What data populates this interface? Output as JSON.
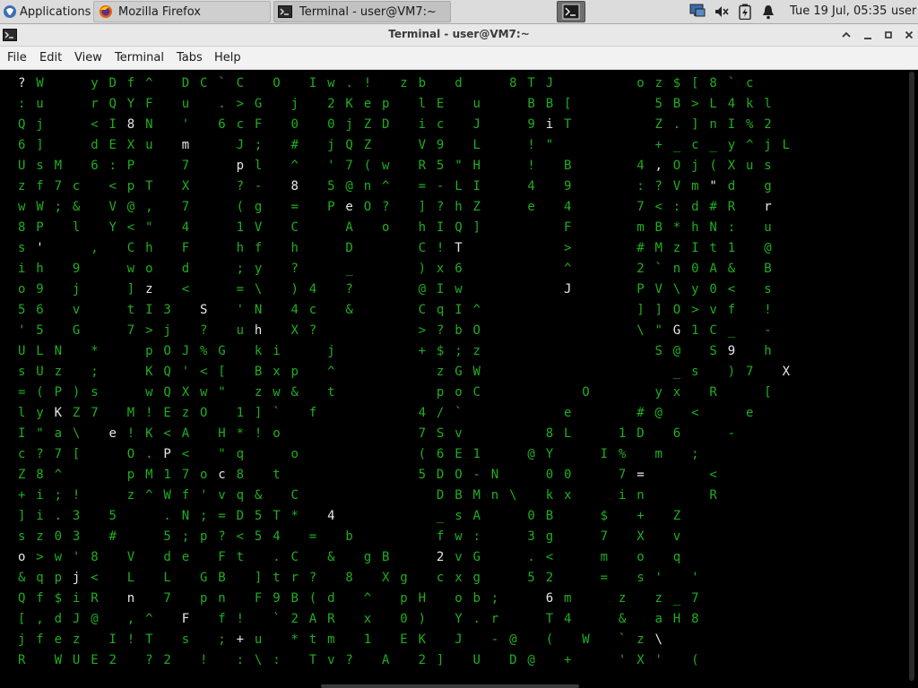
{
  "panel": {
    "apps_label": "Applications",
    "tasks": [
      {
        "label": "Mozilla Firefox"
      },
      {
        "label": "Terminal - user@VM7:~"
      }
    ],
    "clock": "Tue 19 Jul, 05:35",
    "user": "user"
  },
  "window": {
    "title": "Terminal - user@VM7:~"
  },
  "menu": [
    "File",
    "Edit",
    "View",
    "Terminal",
    "Tabs",
    "Help"
  ],
  "terminal": {
    "colors": {
      "bg": "#000000",
      "glyph": "#1fae1f",
      "head": "#e8e8e8"
    },
    "cols": 50,
    "screen": [
      "?W  yDf^ DC`C O Iw.! zb d  8TJ    oz$[8`c",
      ":u  rQYF u .>G j 2Kep lE u  BB[    5B>L4kl",
      "Qj  <I8N ' 6cF 0 0jZD ic J  9iT    Z.]nI%2",
      "6]  dEXu m  J; # jQZ  V9 L  !\"     +_c_y^jL",
      "UsM 6:P  7  pl ^ '7(w R5\"H  ! B   4,Oj(Xus",
      "zf7c <pT X  ?- 8 5@n^ =-LI  4 9   :?Vm\"d g",
      "wW;& V@, 7  (g = PeO? ]?hZ  e 4   7<:d#R r",
      "8P l Y<\" 4  1V C  A o hIQ]    F   mB*hN: u",
      "s'  , Ch F  hf h  D   C!T     >   #MzIt1 @",
      "ih 9  wo d  ;y ?  _   )x6     ^   2`n0A& B",
      "o9 j  ]z <  =\\ )4 ?   @Iw     J   PV\\y0< s",
      "56 v  tI3 S 'N 4c &   CqI^        ]]O>vf !",
      "'5 G  7>j ? uh X?     >?bO        \\\"G1C_ -",
      "ULN *  pOJ%G ki  j    +$;z         S@ S9 h",
      "sUz ;  KQ'<[ Bxp ^     zGW          _s )7 X",
      "=(P)s  wQXw\" zw& t     poC     O   yx R  [",
      "lyKZ7 M!EzO 1]` f     4/`     e   #@ <  e",
      "I\"a\\ e!K<A H*!o       7Sv    8L  1D 6  -",
      "c?7[  O.P< \"q  o      (6E1  @Y  I% m ;",
      "Z8^   pM17oc8 t       5DO-N  00  7=   <",
      "+i;!  z^Wf'vq& C       DBMn\\ kx  in   R",
      "]i.3 5  .N;=D5T* 4     _sA  0B  $ + Z",
      "sz03 #  5;p?<54 = b    fw:  3g  7 X v",
      "o>w'8 V de Ft .C & gB  2vG  .<  m o q",
      "&qpj< L L GB ]tr? 8 Xg cxg  52  = s' '",
      "Qf$iR n 7 pn F9B(d ^ pH ob;  6m  z z_7",
      "[,dJ@ ,^ F f! `2AR x 0) Y.r  T4  & aH8",
      "jfez I!T s ;+u *tm 1 EK J -@ ( W `z\\",
      "R WUE2 ?2 ! :\\: Tv? A 2] U D@ +  'X' ("
    ]
  },
  "icons": {
    "apps": "xfce-mouse-icon",
    "firefox": "firefox-icon",
    "terminal": "terminal-icon",
    "network": "network-icon",
    "volume": "volume-muted-icon",
    "battery": "battery-icon",
    "notifications": "bell-icon"
  }
}
